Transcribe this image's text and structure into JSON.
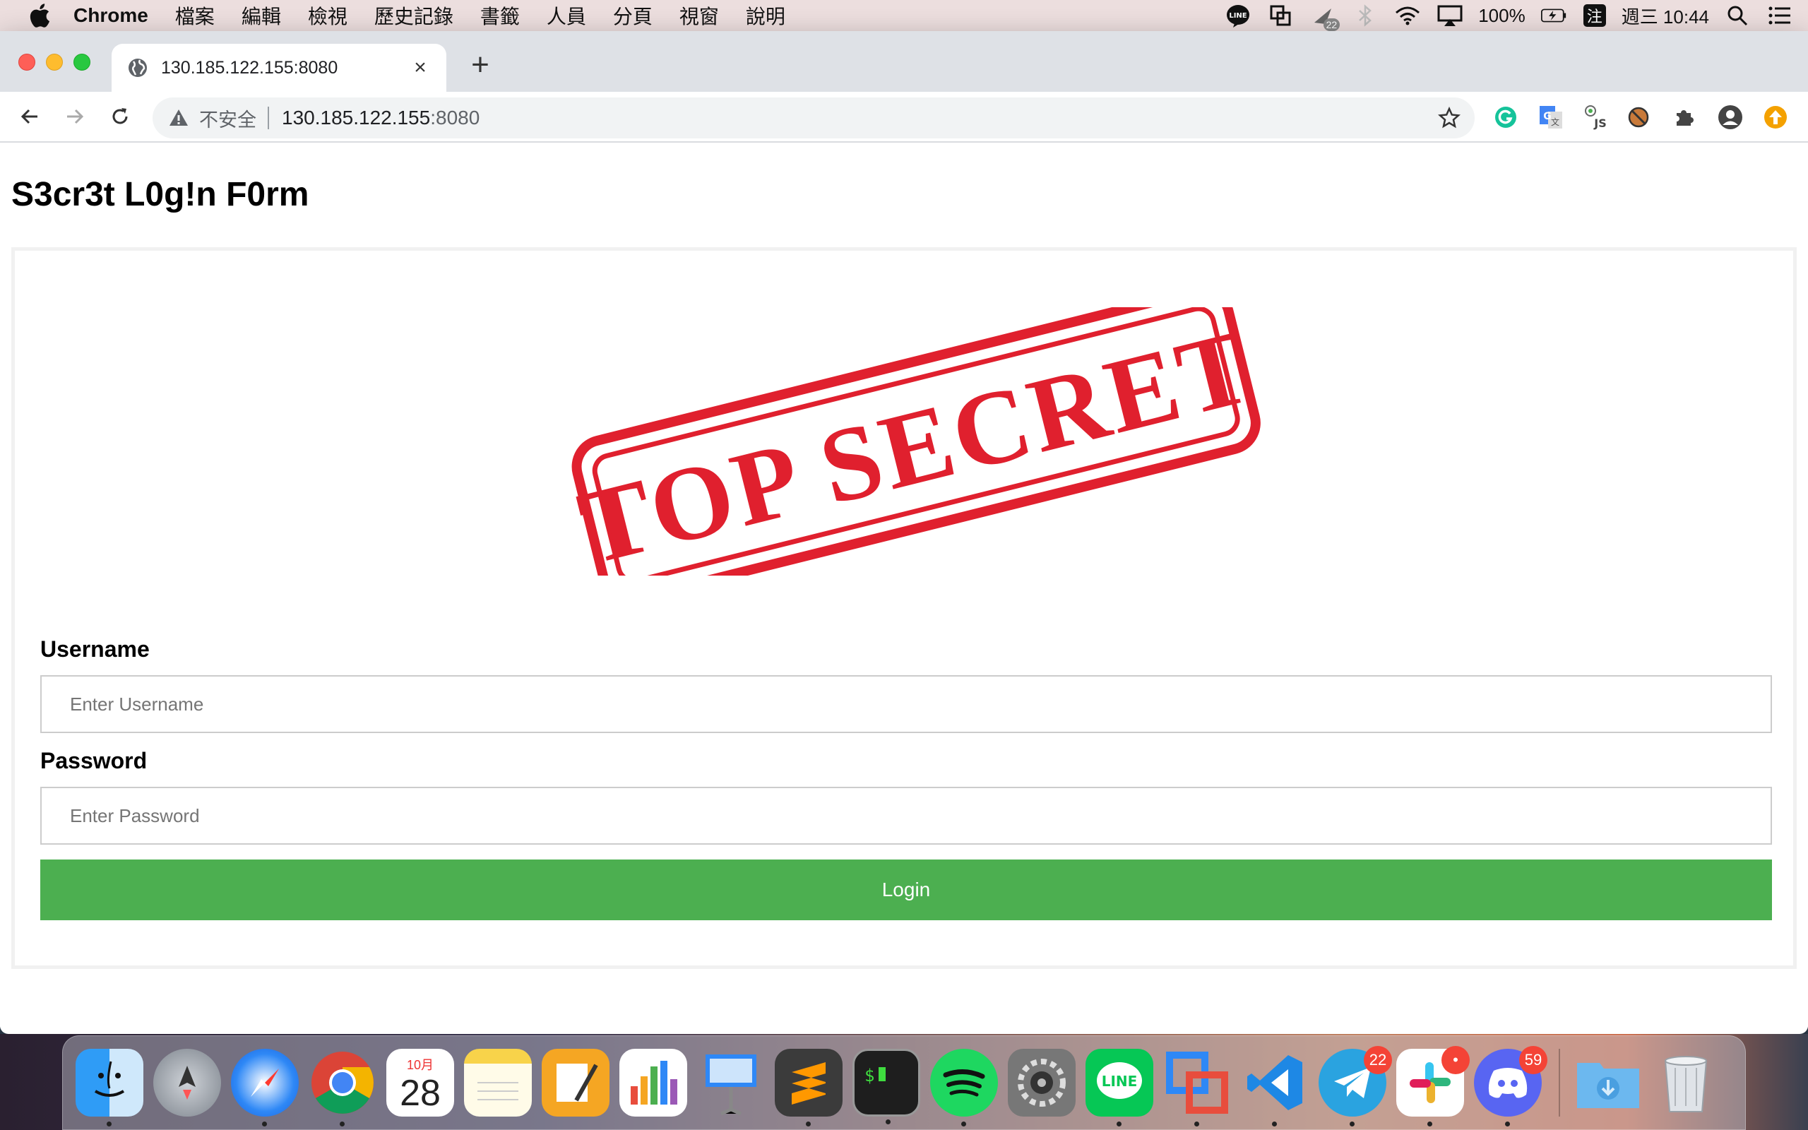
{
  "menubar": {
    "app_name": "Chrome",
    "items": [
      "檔案",
      "編輯",
      "檢視",
      "歷史記錄",
      "書籤",
      "人員",
      "分頁",
      "視窗",
      "說明"
    ],
    "battery": "100%",
    "tray_badge": "22",
    "input_method": "注",
    "clock": "週三 10:44"
  },
  "browser": {
    "tab_title": "130.185.122.155:8080",
    "insecure_label": "不安全",
    "url_host": "130.185.122.155",
    "url_port": ":8080"
  },
  "page": {
    "title": "S3cr3t L0g!n F0rm",
    "stamp_text": "TOP SECRET",
    "username_label": "Username",
    "username_placeholder": "Enter Username",
    "password_label": "Password",
    "password_placeholder": "Enter Password",
    "login_label": "Login"
  },
  "dock": {
    "calendar_month": "10月",
    "calendar_day": "28",
    "telegram_badge": "22",
    "slack_badge": "•",
    "discord_badge": "59"
  },
  "colors": {
    "login_green": "#4caf50",
    "stamp_red": "#e0202e"
  }
}
